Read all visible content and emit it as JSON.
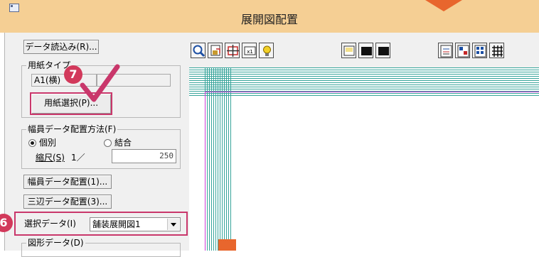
{
  "window": {
    "title": "展開図配置"
  },
  "buttons": {
    "data_load": "データ読込み(R)...",
    "paper_select": "用紙選択(P)...",
    "width_data_place": "幅員データ配置(1)...",
    "three_side_place": "三辺データ配置(3)..."
  },
  "paper_type": {
    "label": "用紙タイプ",
    "value": "A1(横)"
  },
  "placement_method": {
    "label": "幅員データ配置方法(F)",
    "options": [
      "個別",
      "結合"
    ],
    "selected": "個別"
  },
  "scale": {
    "label": "縮尺(S)",
    "prefix": "1／",
    "value": "250"
  },
  "select_data": {
    "label": "選択データ(I)",
    "value": "舗装展開図1"
  },
  "shape_data": {
    "label": "図形データ(D)"
  },
  "callouts": {
    "step6": "6",
    "step7": "7"
  },
  "toolbar_icons": [
    "zoom-icon",
    "import-icon",
    "move-icon",
    "fit-icon",
    "light-bulb-icon",
    "frame-icon",
    "fill-rect-icon",
    "fill-rect-2-icon",
    "list-icon",
    "table-color-icon",
    "table-grid-icon",
    "grid-icon"
  ],
  "colors": {
    "titlebar": "#f5cf94",
    "accent_orange": "#e8662d",
    "callout": "#d2395b",
    "highlight_border": "#c9376b",
    "grid": "#37a49a",
    "paper_outline": "#d13bd8"
  }
}
